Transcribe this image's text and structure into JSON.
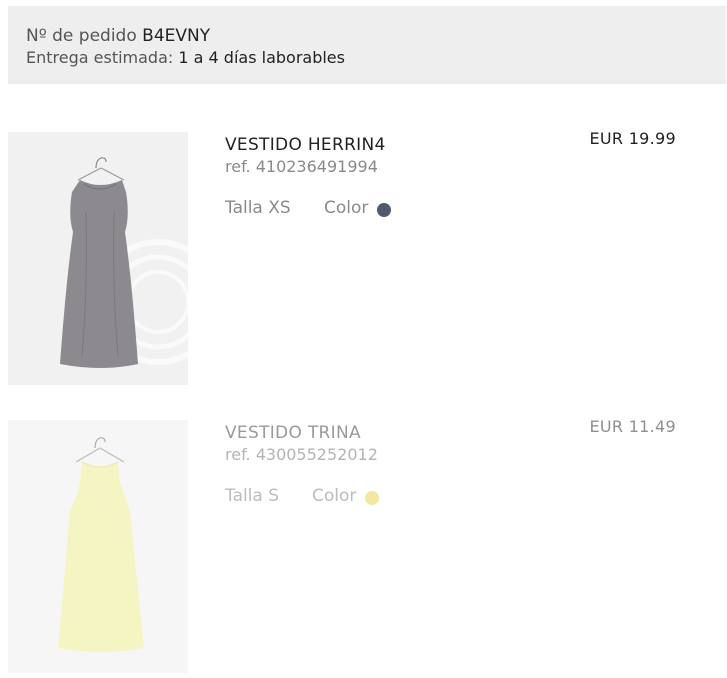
{
  "order": {
    "number_label": "Nº de pedido",
    "number_value": "B4EVNY",
    "delivery_label": "Entrega estimada:",
    "delivery_value": "1 a 4 días laborables"
  },
  "items": [
    {
      "name": "VESTIDO HERRIN4",
      "ref": "ref. 410236491994",
      "size": "Talla XS",
      "color_label": "Color",
      "color_hex": "#505a6e",
      "price": "EUR 19.99",
      "image_icon": "grey-dress-image"
    },
    {
      "name": "VESTIDO TRINA",
      "ref": "ref. 430055252012",
      "size": "Talla S",
      "color_label": "Color",
      "color_hex": "#f3e8a2",
      "price": "EUR 11.49",
      "image_icon": "yellow-dress-image"
    }
  ]
}
